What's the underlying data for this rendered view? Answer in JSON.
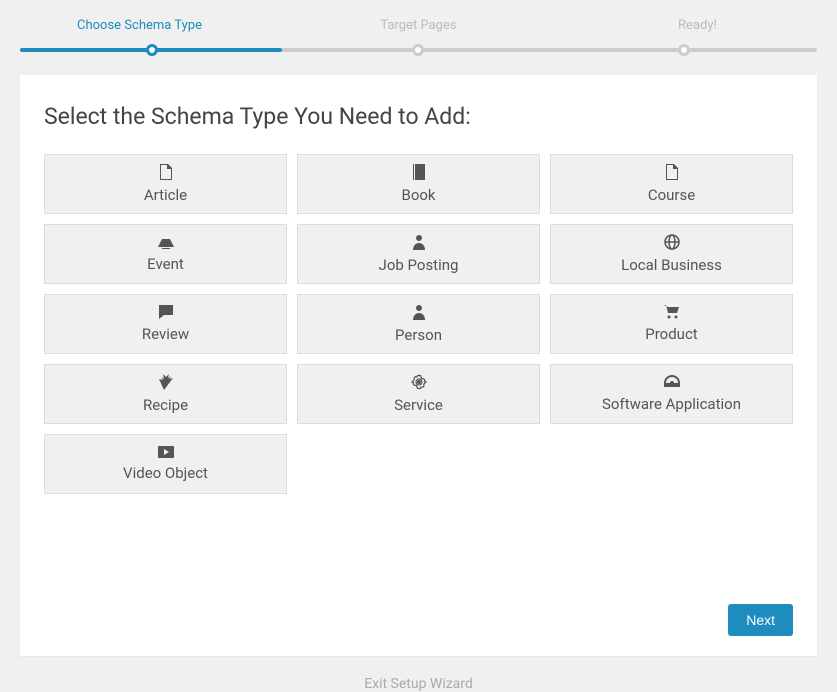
{
  "steps": [
    "Choose Schema Type",
    "Target Pages",
    "Ready!"
  ],
  "active_step_index": 0,
  "heading": "Select the Schema Type You Need to Add:",
  "schema_types": [
    {
      "label": "Article",
      "icon": "file"
    },
    {
      "label": "Book",
      "icon": "book"
    },
    {
      "label": "Course",
      "icon": "file"
    },
    {
      "label": "Event",
      "icon": "event"
    },
    {
      "label": "Job Posting",
      "icon": "user"
    },
    {
      "label": "Local Business",
      "icon": "globe"
    },
    {
      "label": "Review",
      "icon": "comment"
    },
    {
      "label": "Person",
      "icon": "user"
    },
    {
      "label": "Product",
      "icon": "cart"
    },
    {
      "label": "Recipe",
      "icon": "carrot"
    },
    {
      "label": "Service",
      "icon": "gear"
    },
    {
      "label": "Software Application",
      "icon": "dashboard"
    },
    {
      "label": "Video Object",
      "icon": "play"
    }
  ],
  "next_label": "Next",
  "exit_label": "Exit Setup Wizard"
}
